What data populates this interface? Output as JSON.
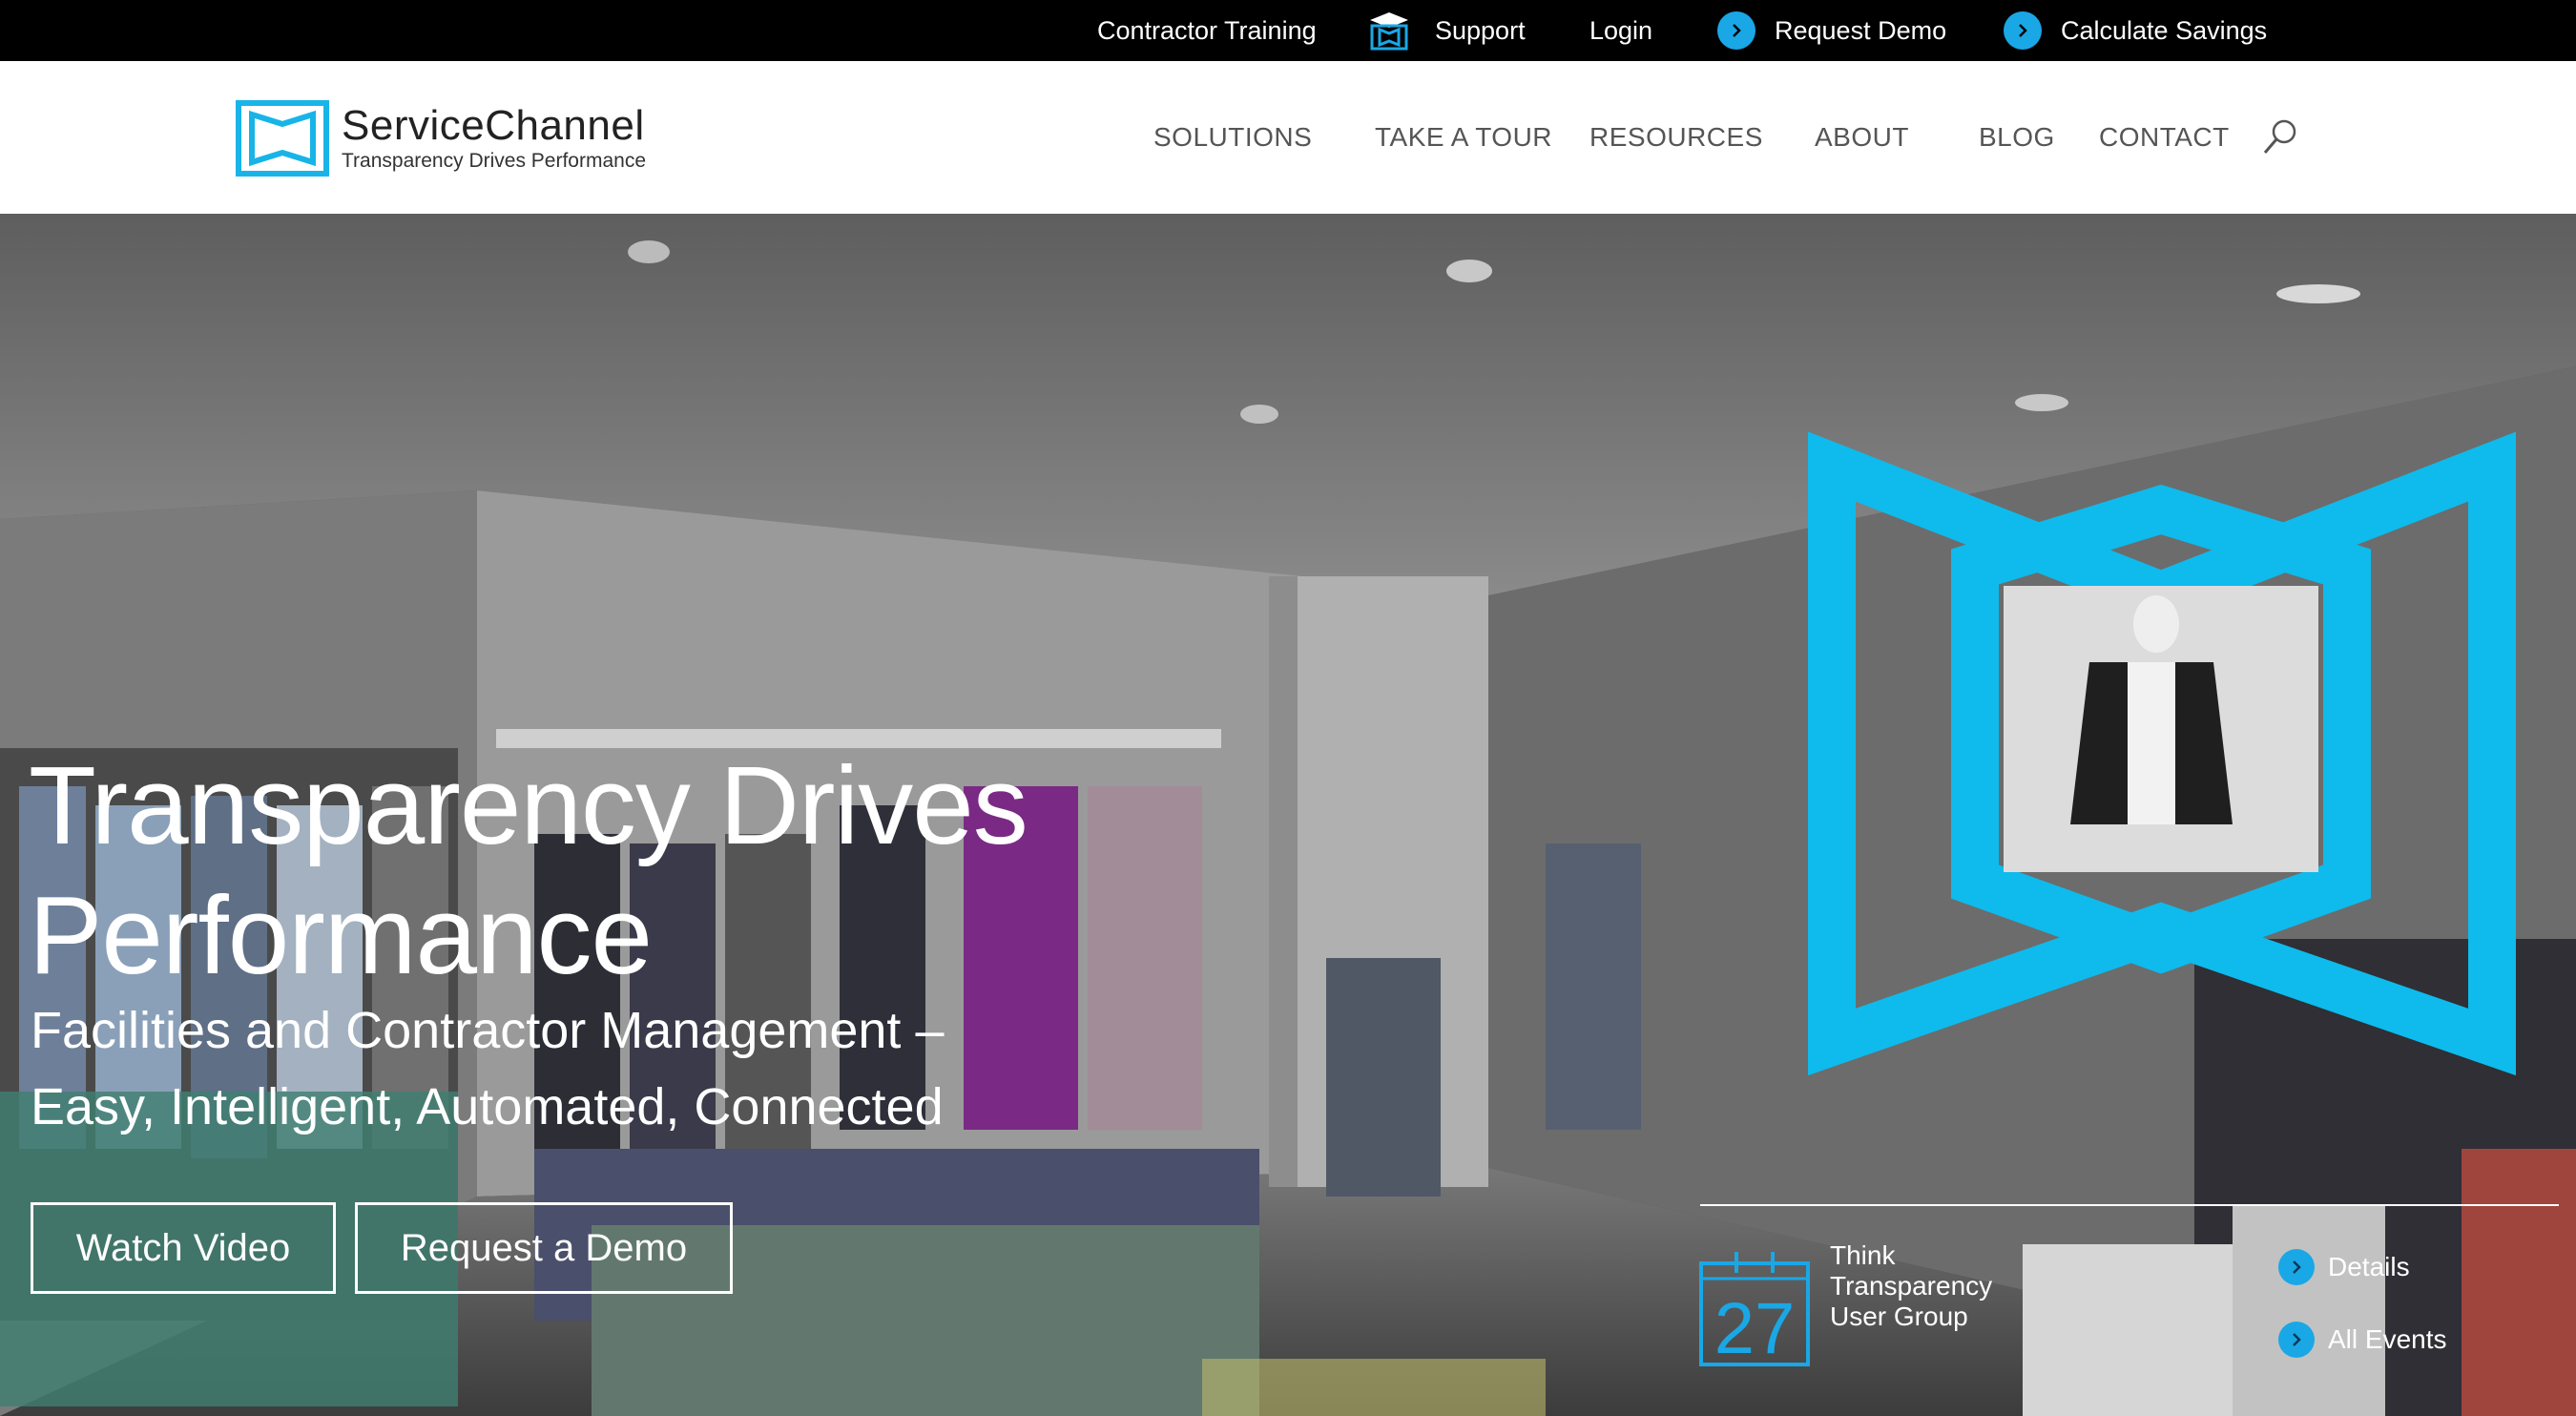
{
  "topbar": {
    "contractor_training": "Contractor Training",
    "support": "Support",
    "login": "Login",
    "request_demo": "Request Demo",
    "calculate_savings": "Calculate Savings"
  },
  "logo": {
    "brand": "ServiceChannel",
    "tagline": "Transparency Drives Performance"
  },
  "nav": {
    "items": [
      "SOLUTIONS",
      "TAKE A TOUR",
      "RESOURCES",
      "ABOUT",
      "BLOG",
      "CONTACT"
    ]
  },
  "hero": {
    "title_line1": "Transparency Drives",
    "title_line2": "Performance",
    "subtitle_line1": "Facilities and Contractor Management –",
    "subtitle_line2": "Easy, Intelligent, Automated, Connected",
    "watch_video": "Watch Video",
    "request_demo": "Request a Demo"
  },
  "event": {
    "day": "27",
    "title_line1": "Think",
    "title_line2": "Transparency",
    "title_line3": "User Group",
    "details": "Details",
    "all_events": "All Events"
  },
  "colors": {
    "accent": "#1aa7e6",
    "logo_blue": "#18b4e8",
    "topbar_bg": "#000000",
    "nav_text": "#555555"
  }
}
